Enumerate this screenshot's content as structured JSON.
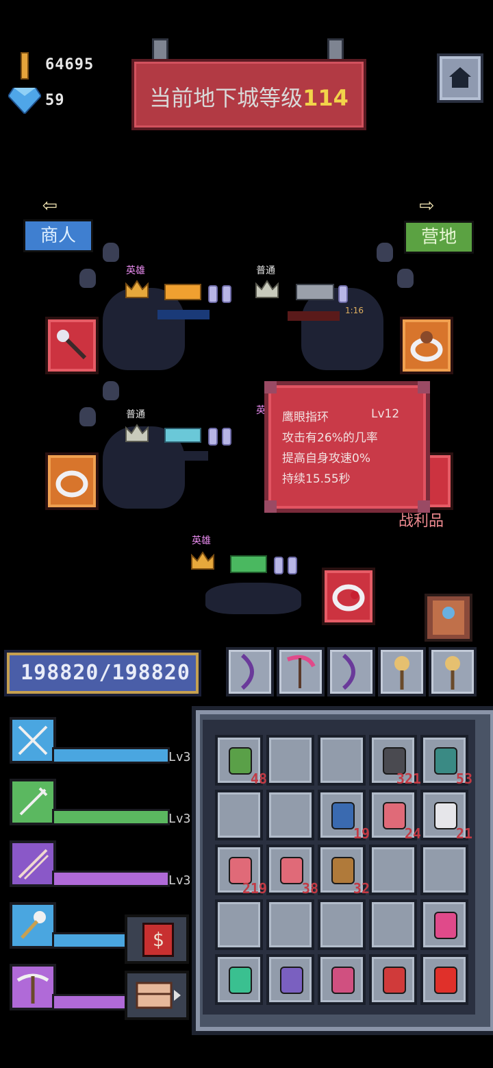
{
  "currency": {
    "gold": "64695",
    "diamonds": "59"
  },
  "banner": {
    "prefix": "当前地下城等级",
    "level": "114"
  },
  "nav": {
    "left_label": "商人",
    "right_label": "营地"
  },
  "enemies": [
    {
      "rank": "英雄",
      "rank_class": "hero"
    },
    {
      "rank": "普通",
      "rank_class": "normal",
      "timer": "1:16"
    },
    {
      "rank": "普通",
      "rank_class": "normal"
    },
    {
      "rank": "英",
      "rank_class": "hero"
    },
    {
      "rank": "英雄",
      "rank_class": "hero"
    }
  ],
  "tooltip": {
    "name": "鹰眼指环",
    "level": "Lv12",
    "line1": "攻击有26%的几率",
    "line2": "提高自身攻速0%",
    "line3": "持续15.55秒"
  },
  "loot_label": "战利品",
  "hp": {
    "text": "198820/198820"
  },
  "skills": [
    {
      "level": "Lv3",
      "color": "#4aa6e0",
      "icon": "crossed-arrows-icon"
    },
    {
      "level": "Lv3",
      "color": "#5bb860",
      "icon": "trident-icon"
    },
    {
      "level": "Lv3",
      "color": "#8a58c8",
      "icon": "arrows-icon"
    },
    {
      "level": "",
      "color": "#4aa6e0",
      "icon": "mace-icon"
    },
    {
      "level": "",
      "color": "#b06ad8",
      "icon": "pickaxe-icon"
    }
  ],
  "side_buttons": {
    "shop_symbol": "$"
  },
  "inventory": {
    "rows": [
      [
        {
          "item": "green-jar-icon",
          "qty": "48"
        },
        {
          "item": "",
          "qty": ""
        },
        {
          "item": "",
          "qty": ""
        },
        {
          "item": "stone-icon",
          "qty": "321"
        },
        {
          "item": "teal-potion-icon",
          "qty": "53"
        }
      ],
      [
        {
          "item": "",
          "qty": ""
        },
        {
          "item": "",
          "qty": ""
        },
        {
          "item": "blue-gourd-icon",
          "qty": "19"
        },
        {
          "item": "red-potion-icon",
          "qty": "24"
        },
        {
          "item": "white-potion-icon",
          "qty": "21"
        }
      ],
      [
        {
          "item": "red-potion-icon",
          "qty": "219"
        },
        {
          "item": "red-potion-icon",
          "qty": "38"
        },
        {
          "item": "brown-gourd-icon",
          "qty": "32"
        },
        {
          "item": "",
          "qty": ""
        },
        {
          "item": "",
          "qty": ""
        }
      ],
      [
        {
          "item": "",
          "qty": ""
        },
        {
          "item": "",
          "qty": ""
        },
        {
          "item": "",
          "qty": ""
        },
        {
          "item": "",
          "qty": ""
        },
        {
          "item": "pink-scythe-icon",
          "qty": ""
        }
      ],
      [
        {
          "item": "green-book-icon",
          "qty": ""
        },
        {
          "item": "purple-book-icon",
          "qty": ""
        },
        {
          "item": "pink-book-icon",
          "qty": ""
        },
        {
          "item": "red-book-icon",
          "qty": ""
        },
        {
          "item": "red-sword-icon",
          "qty": ""
        }
      ]
    ]
  }
}
